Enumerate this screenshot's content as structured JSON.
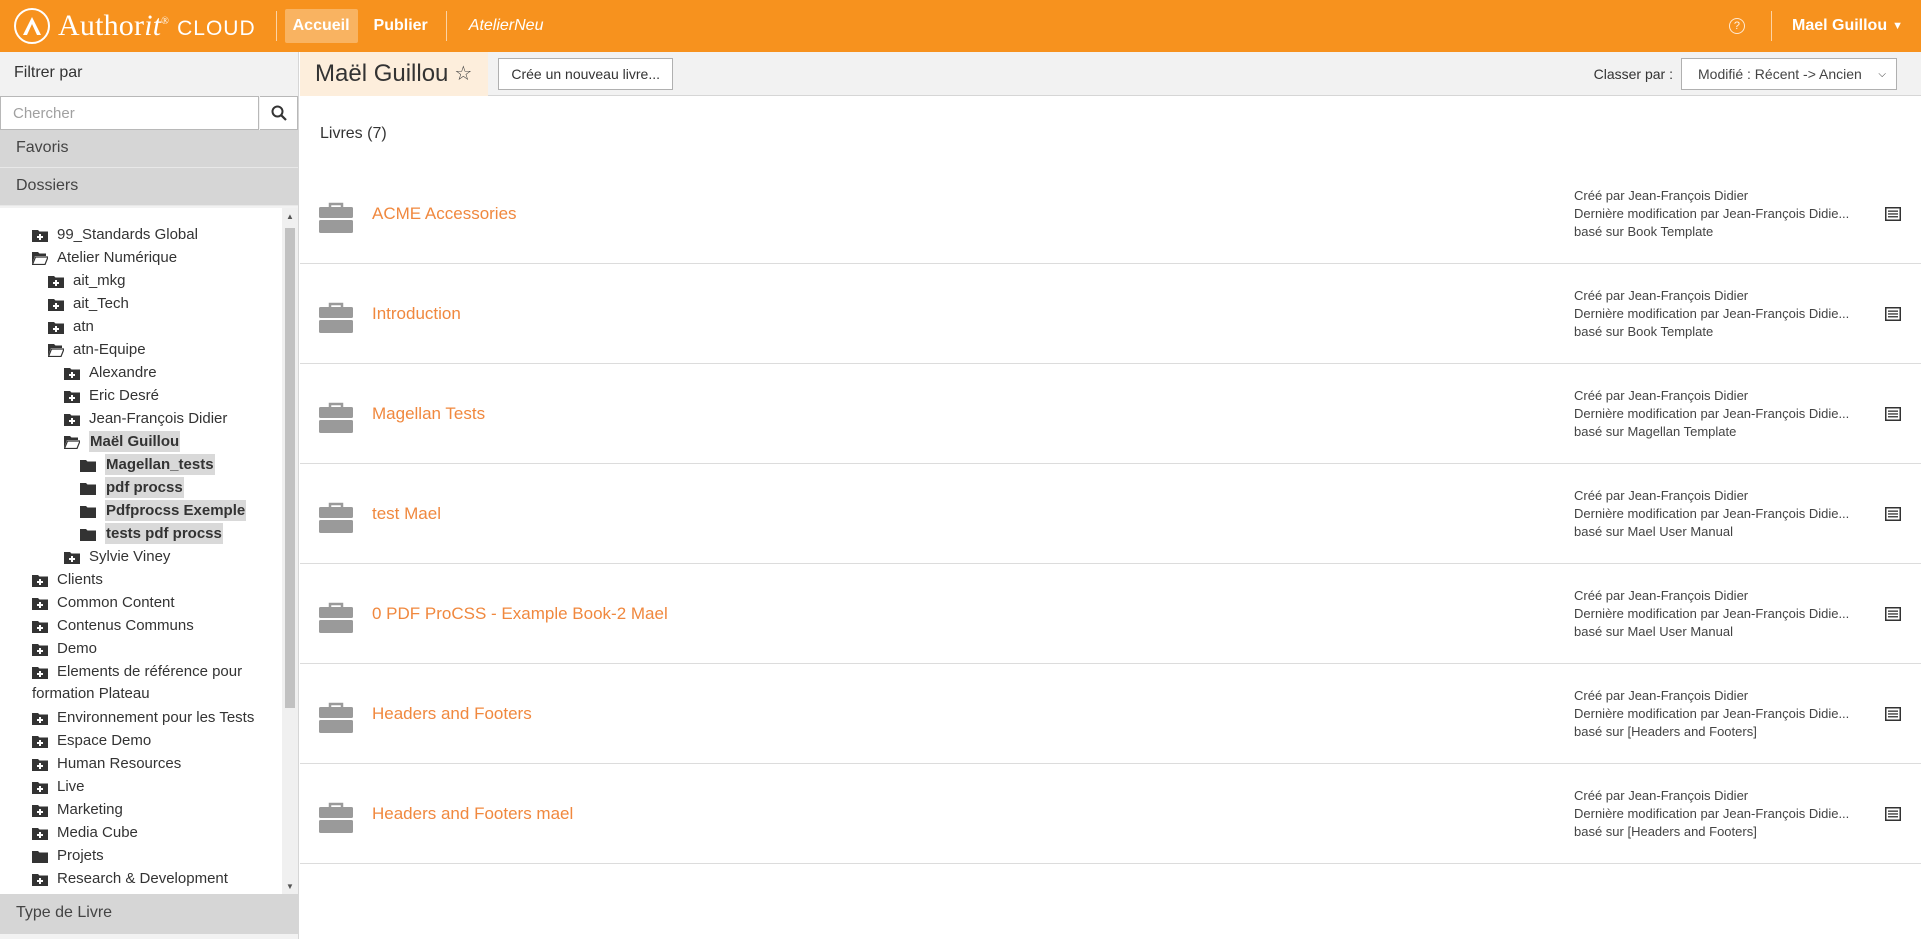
{
  "app": {
    "logo_brand": "Author",
    "logo_it": "it",
    "logo_cloud": "CLOUD",
    "nav": [
      "Accueil",
      "Publier",
      "AtelierNeu"
    ],
    "help_icon": "question-circle-icon",
    "user_name": "Mael Guillou"
  },
  "sidebar": {
    "filter_title": "Filtrer par",
    "search_placeholder": "Chercher",
    "sections": [
      "Favoris",
      "Dossiers"
    ],
    "tree": [
      {
        "label": "99_Standards Global",
        "level": 0,
        "icon": "folder-plus-icon"
      },
      {
        "label": "Atelier Numérique",
        "level": 0,
        "icon": "folder-open-icon"
      },
      {
        "label": "ait_mkg",
        "level": 1,
        "icon": "folder-plus-icon"
      },
      {
        "label": "ait_Tech",
        "level": 1,
        "icon": "folder-plus-icon"
      },
      {
        "label": "atn",
        "level": 1,
        "icon": "folder-plus-icon"
      },
      {
        "label": "atn-Equipe",
        "level": 1,
        "icon": "folder-open-icon"
      },
      {
        "label": "Alexandre",
        "level": 2,
        "icon": "folder-plus-icon"
      },
      {
        "label": "Eric Desré",
        "level": 2,
        "icon": "folder-plus-icon"
      },
      {
        "label": "Jean-François Didier",
        "level": 2,
        "icon": "folder-plus-icon"
      },
      {
        "label": "Maël Guillou",
        "level": 2,
        "icon": "folder-open-icon",
        "selected": true
      },
      {
        "label": "Magellan_tests",
        "level": 3,
        "icon": "folder-icon",
        "selected": true
      },
      {
        "label": "pdf procss",
        "level": 3,
        "icon": "folder-icon",
        "selected": true
      },
      {
        "label": "Pdfprocss Exemple",
        "level": 3,
        "icon": "folder-icon",
        "selected": true
      },
      {
        "label": "tests pdf procss",
        "level": 3,
        "icon": "folder-icon",
        "selected": true
      },
      {
        "label": "Sylvie Viney",
        "level": 2,
        "icon": "folder-plus-icon"
      },
      {
        "label": "Clients",
        "level": 0,
        "icon": "folder-plus-icon"
      },
      {
        "label": "Common Content",
        "level": 0,
        "icon": "folder-plus-icon"
      },
      {
        "label": "Contenus Communs",
        "level": 0,
        "icon": "folder-plus-icon"
      },
      {
        "label": "Demo",
        "level": 0,
        "icon": "folder-plus-icon"
      },
      {
        "label": "Elements de référence pour formation Plateau",
        "level": 0,
        "icon": "folder-plus-icon",
        "wrap": true
      },
      {
        "label": "Environnement pour les Tests",
        "level": 0,
        "icon": "folder-plus-icon"
      },
      {
        "label": "Espace Demo",
        "level": 0,
        "icon": "folder-plus-icon"
      },
      {
        "label": "Human Resources",
        "level": 0,
        "icon": "folder-plus-icon"
      },
      {
        "label": "Live",
        "level": 0,
        "icon": "folder-plus-icon"
      },
      {
        "label": "Marketing",
        "level": 0,
        "icon": "folder-plus-icon"
      },
      {
        "label": "Media Cube",
        "level": 0,
        "icon": "folder-plus-icon"
      },
      {
        "label": "Projets",
        "level": 0,
        "icon": "folder-icon"
      },
      {
        "label": "Research & Development",
        "level": 0,
        "icon": "folder-plus-icon"
      }
    ],
    "type_livre": "Type de Livre"
  },
  "main": {
    "page_title": "Maël Guillou",
    "star_icon": "star-outline-icon",
    "new_book_label": "Crée un nouveau livre...",
    "sort_label": "Classer par :",
    "sort_value": "Modifié : Récent -> Ancien",
    "books_count": "Livres (7)",
    "books": [
      {
        "title": "ACME Accessories",
        "created": "Créé par Jean-François Didier",
        "modified": "Dernière modification par Jean-François Didie...",
        "based": "basé sur Book Template"
      },
      {
        "title": "Introduction",
        "created": "Créé par Jean-François Didier",
        "modified": "Dernière modification par Jean-François Didie...",
        "based": "basé sur Book Template"
      },
      {
        "title": "Magellan Tests",
        "created": "Créé par Jean-François Didier",
        "modified": "Dernière modification par Jean-François Didie...",
        "based": "basé sur Magellan Template"
      },
      {
        "title": "test Mael",
        "created": "Créé par Jean-François Didier",
        "modified": "Dernière modification par Jean-François Didie...",
        "based": "basé sur Mael User Manual"
      },
      {
        "title": "0 PDF ProCSS - Example Book-2 Mael",
        "created": "Créé par Jean-François Didier",
        "modified": "Dernière modification par Jean-François Didie...",
        "based": "basé sur Mael User Manual"
      },
      {
        "title": "Headers and Footers",
        "created": "Créé par Jean-François Didier",
        "modified": "Dernière modification par Jean-François Didie...",
        "based": "basé sur [Headers and Footers]"
      },
      {
        "title": "Headers and Footers mael",
        "created": "Créé par Jean-François Didier",
        "modified": "Dernière modification par Jean-François Didie...",
        "based": "basé sur [Headers and Footers]"
      }
    ]
  },
  "colors": {
    "accent": "#f7921e",
    "link": "#f0883e",
    "selected_bg": "#d9d9d9"
  }
}
